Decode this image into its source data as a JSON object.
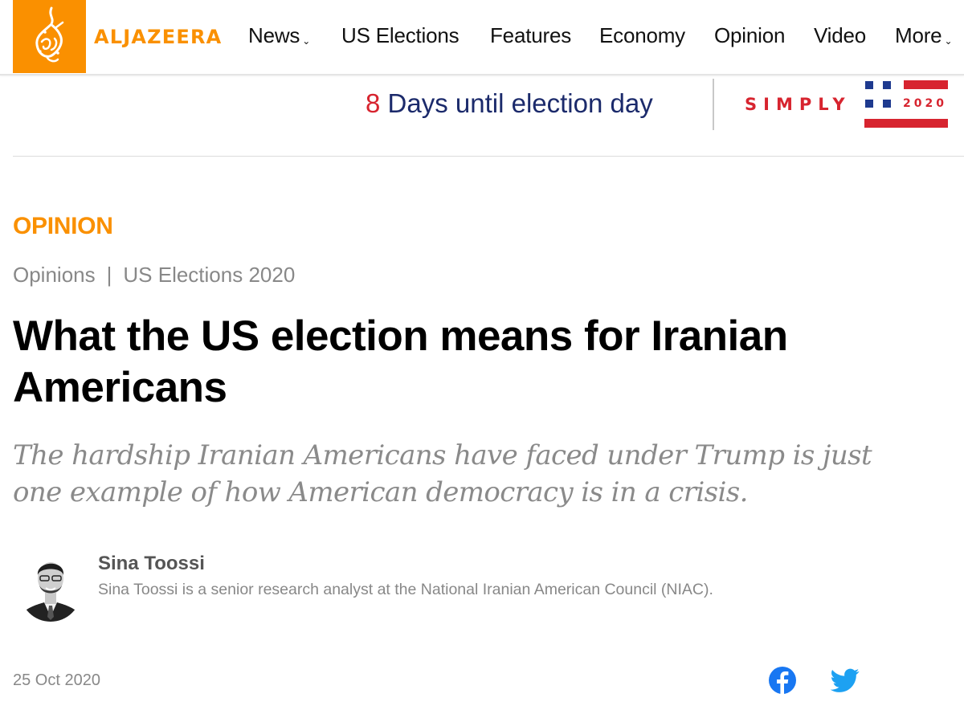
{
  "header": {
    "logo_text": "ALJAZEERA",
    "brand_color": "#fa9000",
    "nav": [
      {
        "label": "News",
        "has_dropdown": true
      },
      {
        "label": "US Elections",
        "has_dropdown": false
      },
      {
        "label": "Features",
        "has_dropdown": false
      },
      {
        "label": "Economy",
        "has_dropdown": false
      },
      {
        "label": "Opinion",
        "has_dropdown": false
      },
      {
        "label": "Video",
        "has_dropdown": false
      },
      {
        "label": "More",
        "has_dropdown": true
      }
    ],
    "chevron_glyph": "⌄"
  },
  "election_banner": {
    "days_count": "8",
    "days_text": "Days until election day",
    "brand_word": "SIMPLY",
    "brand_year": "2020",
    "accent_red": "#d7242f",
    "accent_blue": "#1e3a8f"
  },
  "article": {
    "kicker": "OPINION",
    "breadcrumb": [
      "Opinions",
      "US Elections 2020"
    ],
    "breadcrumb_separator": "|",
    "headline": "What the US election means for Iranian Americans",
    "standfirst": "The hardship Iranian Americans have faced under Trump is just one example of how American democracy is in a crisis.",
    "author": {
      "name": "Sina Toossi",
      "bio": "Sina Toossi is a senior research analyst at the National Iranian American Council (NIAC)."
    },
    "date": "25 Oct 2020",
    "share": [
      {
        "network": "facebook",
        "color": "#1877f2"
      },
      {
        "network": "twitter",
        "color": "#1da1f2"
      }
    ]
  }
}
